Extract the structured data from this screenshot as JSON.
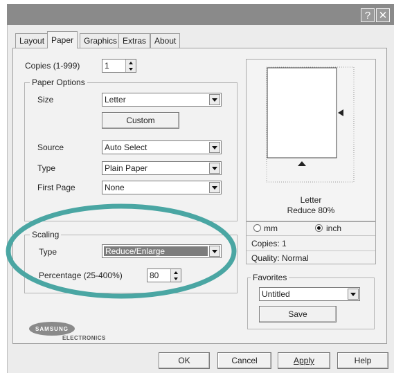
{
  "titlebar": {
    "help_glyph": "?",
    "close_glyph": "✕"
  },
  "tabs": [
    {
      "label": "Layout"
    },
    {
      "label": "Paper",
      "active": true
    },
    {
      "label": "Graphics"
    },
    {
      "label": "Extras"
    },
    {
      "label": "About"
    }
  ],
  "copies": {
    "label": "Copies (1-999)",
    "value": "1"
  },
  "paper_options": {
    "legend": "Paper Options",
    "size_label": "Size",
    "size_value": "Letter",
    "custom_label": "Custom",
    "source_label": "Source",
    "source_value": "Auto Select",
    "type_label": "Type",
    "type_value": "Plain Paper",
    "first_page_label": "First Page",
    "first_page_value": "None"
  },
  "scaling": {
    "legend": "Scaling",
    "type_label": "Type",
    "type_value": "Reduce/Enlarge",
    "percentage_label": "Percentage (25-400%)",
    "percentage_value": "80"
  },
  "preview": {
    "paper_name": "Letter",
    "reduce_text": "Reduce 80%",
    "unit_mm": "mm",
    "unit_inch": "inch",
    "selected_unit": "inch",
    "copies_text": "Copies: 1",
    "quality_text": "Quality: Normal"
  },
  "favorites": {
    "legend": "Favorites",
    "value": "Untitled",
    "save_label": "Save"
  },
  "logo": {
    "brand": "SAMSUNG",
    "sub": "ELECTRONICS"
  },
  "footer": {
    "ok": "OK",
    "cancel": "Cancel",
    "apply": "Apply",
    "help": "Help"
  },
  "colors": {
    "highlight_ring": "#4aa6a3",
    "titlebar": "#8a8a8a",
    "selection": "#7d7d7d"
  },
  "icons": {
    "help": "question-mark-icon",
    "close": "close-icon",
    "dropdown": "chevron-down-icon",
    "spinner": "spin-arrows-icon",
    "radio": "radio-icon"
  }
}
